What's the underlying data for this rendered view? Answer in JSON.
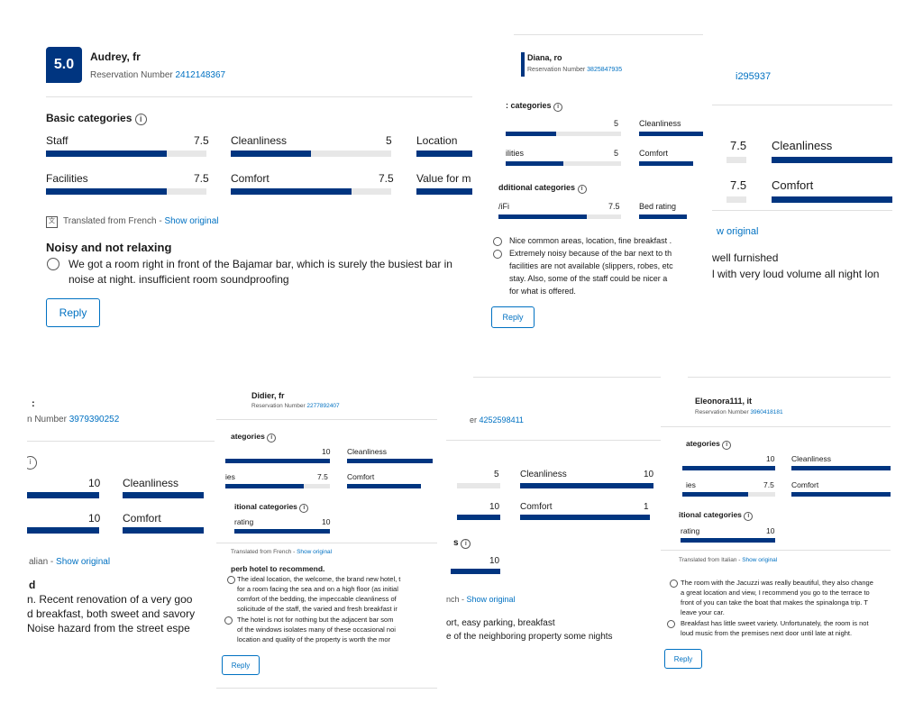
{
  "c1": {
    "score": "5.0",
    "name": "Audrey, fr",
    "res_label": "Reservation Number",
    "res_num": "2412148367",
    "basic": "Basic categories",
    "r1": [
      {
        "label": "Staff",
        "value": "7.5"
      },
      {
        "label": "Cleanliness",
        "value": "5"
      },
      {
        "label": "Location",
        "value": ""
      }
    ],
    "r2": [
      {
        "label": "Facilities",
        "value": "7.5"
      },
      {
        "label": "Comfort",
        "value": "7.5"
      },
      {
        "label": "Value for m",
        "value": ""
      }
    ],
    "translated": "Translated from French -",
    "show": "Show original",
    "title": "Noisy and not relaxing",
    "neg1": "We got a room right in front of the Bajamar bar, which is surely the busiest bar in",
    "neg2": "noise at night. insufficient room soundproofing",
    "reply": "Reply"
  },
  "c2": {
    "name": "Diana, ro",
    "res_label": "Reservation Number",
    "res_num": "3825847935",
    "basic": ": categories",
    "l1": "5",
    "l1b": "Cleanliness",
    "l2a": "ilities",
    "l2": "5",
    "l2b": "Comfort",
    "add": "dditional categories",
    "l3a": "/iFi",
    "l3": "7.5",
    "l3b": "Bed rating",
    "pos": "Nice common areas, location, fine breakfast .",
    "neg": [
      "Extremely noisy because of the bar next to th",
      "facilities are not available (slippers, robes, etc",
      "stay. Also, some of the staff could be nicer a",
      "for what is offered."
    ],
    "reply": "Reply"
  },
  "c3": {
    "res_num": "i295937",
    "v1": "7.5",
    "l1": "Cleanliness",
    "v2": "7.5",
    "l2": "Comfort",
    "show": "w original",
    "t1": "well furnished",
    "t2": "l with very loud volume all night lon"
  },
  "c4": {
    "title": ":",
    "res_label": "n Number",
    "res_num": "3979390252",
    "v1": "10",
    "l1": "Cleanliness",
    "v2": "10",
    "l2": "Comfort",
    "trans": "alian -",
    "show": "Show original",
    "h": "d",
    "t1": "n. Recent renovation of a very goo",
    "t2": "d breakfast, both sweet and savory",
    "t3": "Noise hazard from the street espe"
  },
  "c5": {
    "name": "Didier, fr",
    "res_label": "Reservation Number",
    "res_num": "2277892407",
    "basic": "ategories",
    "v1": "10",
    "l1": "Cleanliness",
    "l2a": "ies",
    "v2": "7.5",
    "l2": "Comfort",
    "add": "itional categories",
    "l3a": "rating",
    "v3": "10",
    "trans": "Translated from French -",
    "show": "Show original",
    "title": "perb hotel to recommend.",
    "pos": [
      "The ideal location, the welcome, the brand new hotel, t",
      "for a room facing the sea and on a high floor (as initial",
      "comfort of the bedding, the impeccable cleanliness of",
      "solicitude of the staff, the varied and fresh breakfast ir"
    ],
    "neg": [
      "The hotel is not for nothing but the adjacent bar som",
      "of the windows isolates many of these occasional noi",
      "location and quality of the property is worth the mor"
    ],
    "reply": "Reply"
  },
  "c6": {
    "res_label": "er",
    "res_num": "4252598411",
    "v1": "5",
    "l1": "Cleanliness",
    "v1b": "10",
    "v2": "10",
    "l2": "Comfort",
    "v2b": "1",
    "add": "s",
    "v3": "10",
    "trans": "nch -",
    "show": "Show original",
    "t1": "ort, easy parking, breakfast",
    "t2": "e of the neighboring property some nights"
  },
  "c7": {
    "name": "Eleonora111, it",
    "res_label": "Reservation Number",
    "res_num": "3960418181",
    "basic": "ategories",
    "v1": "10",
    "l1": "Cleanliness",
    "l2a": "ies",
    "v2": "7.5",
    "l2": "Comfort",
    "add": "itional categories",
    "l3a": "rating",
    "v3": "10",
    "trans": "Translated from Italian -",
    "show": "Show original",
    "pos": [
      "The room with the Jacuzzi was really beautiful, they also change",
      "a great location and view, I recommend you go to the terrace to",
      "front of you can take the boat that makes the spinalonga trip. T",
      "leave your car."
    ],
    "neg": [
      "Breakfast has little sweet variety. Unfortunately, the room is not",
      "loud music from the premises next door until late at night."
    ],
    "reply": "Reply"
  }
}
